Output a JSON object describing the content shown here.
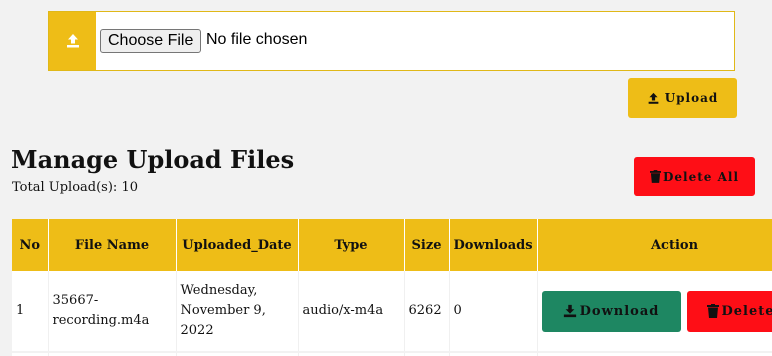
{
  "upload": {
    "choose_file_label": "Choose File",
    "file_status": "No file chosen",
    "upload_button": "Upload"
  },
  "manage": {
    "title": "Manage Upload Files",
    "total_label": "Total Upload(s):",
    "total_count": "10",
    "delete_all_label": "Delete All"
  },
  "table": {
    "headers": [
      "No",
      "File Name",
      "Uploaded_Date",
      "Type",
      "Size",
      "Downloads",
      "Action"
    ],
    "rows": [
      {
        "no": "1",
        "file_name": "35667-recording.m4a",
        "uploaded_date": "Wednesday, November 9, 2022",
        "type": "audio/x-m4a",
        "size": "6262",
        "downloads": "0",
        "download_label": "Download",
        "delete_label": "Delete"
      }
    ]
  },
  "colors": {
    "accent": "#eebd17",
    "danger": "#fe0e16",
    "success": "#1e8762",
    "background": "#f2f2f2"
  },
  "icons": [
    "upload-icon",
    "trash-icon",
    "download-icon"
  ]
}
